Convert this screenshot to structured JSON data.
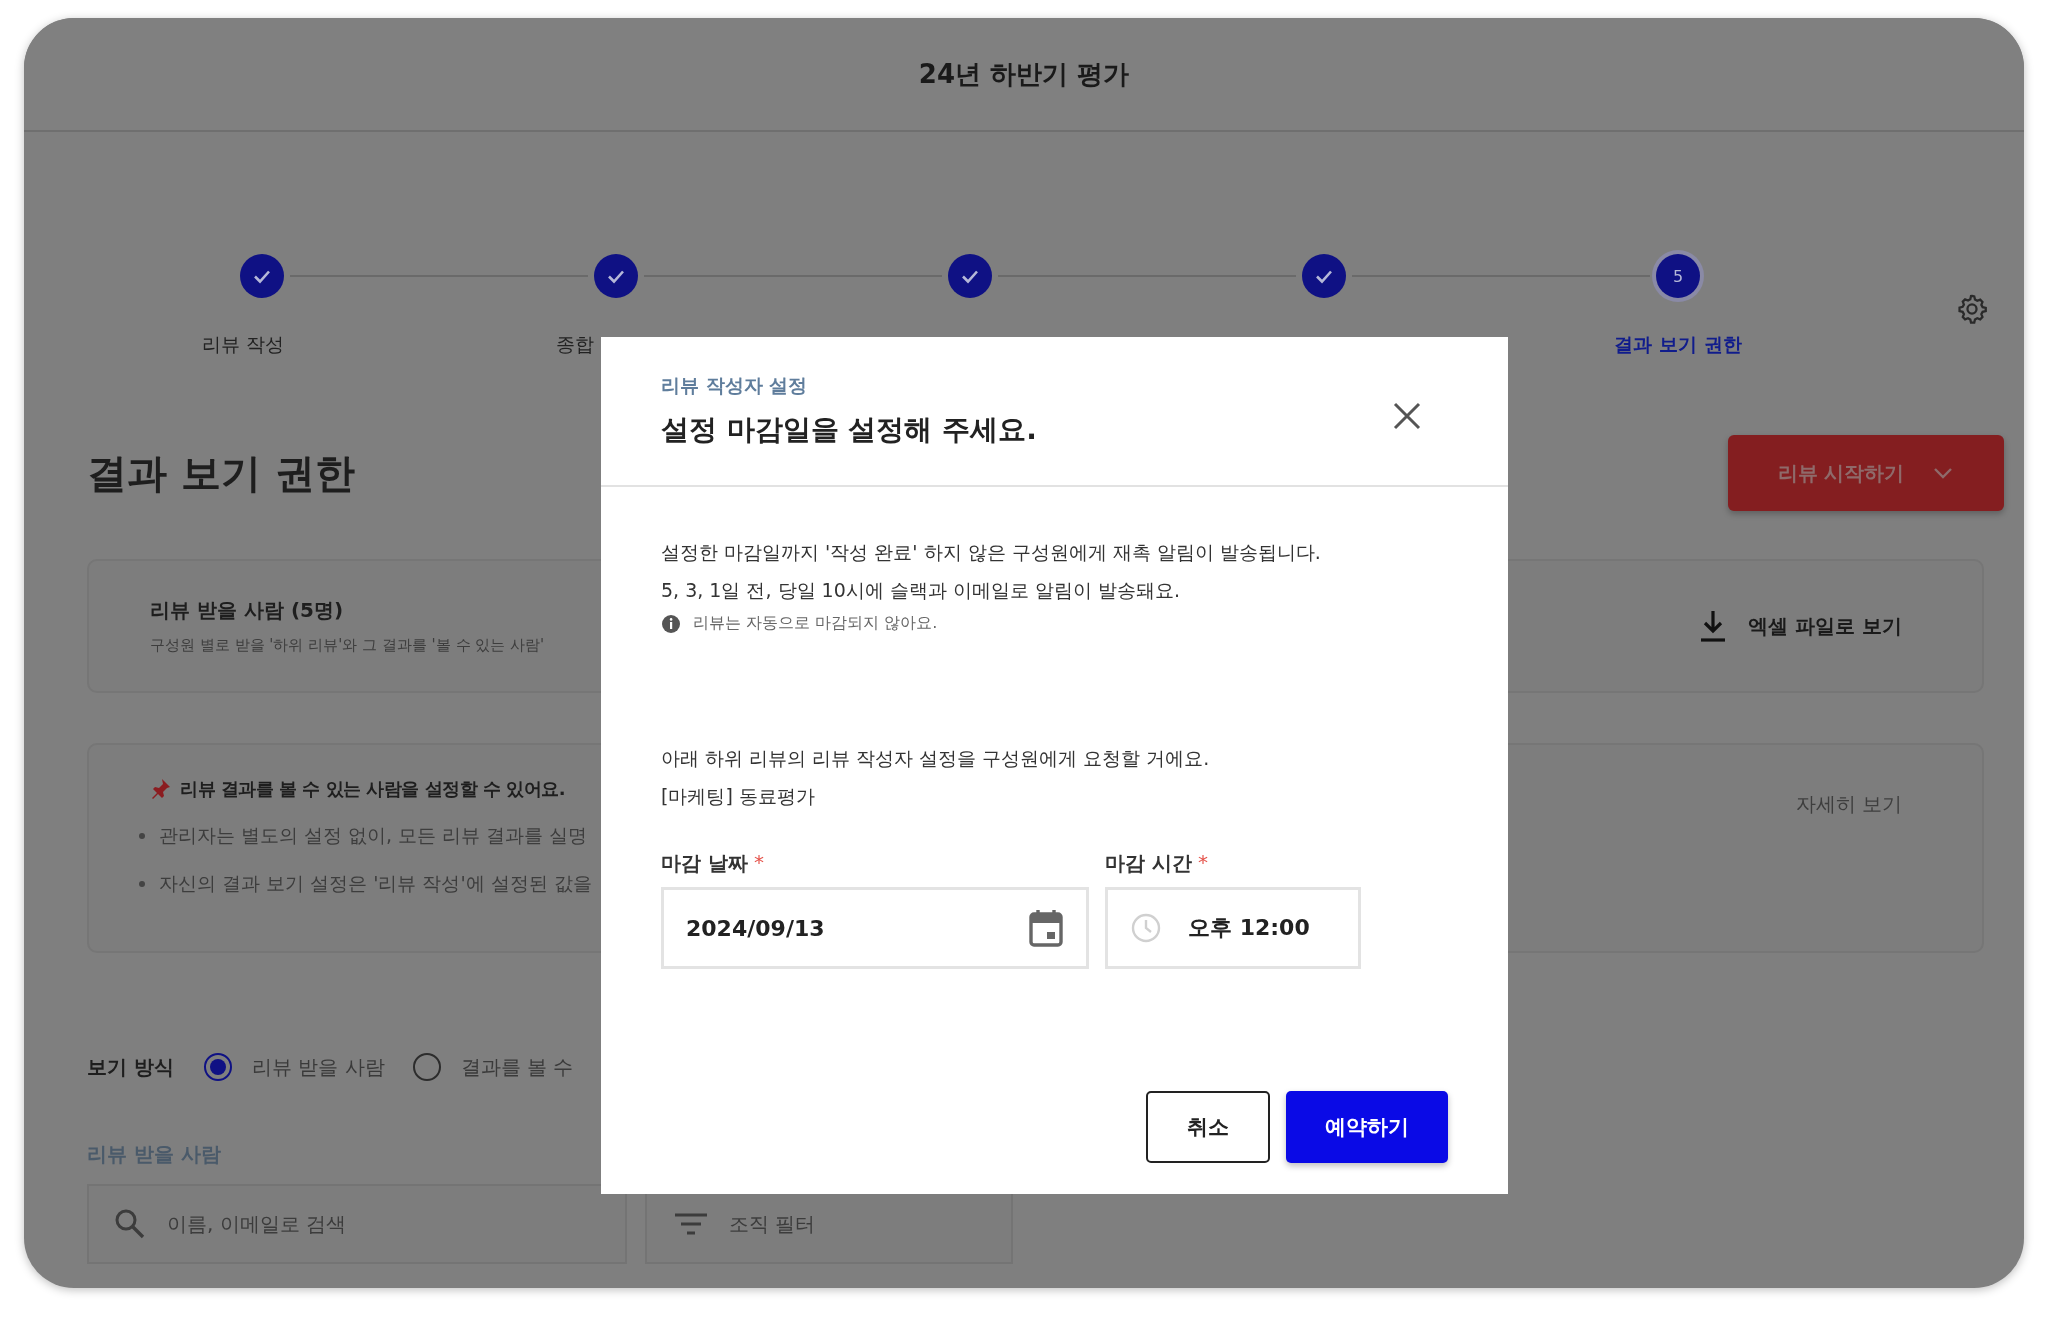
{
  "window": {
    "title": "24년 하반기 평가"
  },
  "steps": [
    {
      "label": "리뷰 작성",
      "done": true,
      "selected": false
    },
    {
      "label": "종합",
      "done": true,
      "selected": false
    },
    {
      "done": true,
      "selected": false
    },
    {
      "done": true,
      "selected": false
    },
    {
      "number": "5",
      "label": "결과 보기 권한",
      "done": false,
      "selected": true
    }
  ],
  "page_heading": "결과 보기 권한",
  "start_button": {
    "label": "리뷰 시작하기"
  },
  "reviewees_card": {
    "title": "리뷰 받을 사람 (5명)",
    "description": "구성원 별로 받을 '하위 리뷰'와 그 결과를 '볼 수 있는 사람'",
    "excel_link": "엑셀 파일로 보기"
  },
  "notice": {
    "title": "리뷰 결과를 볼 수 있는 사람을 설정할 수 있어요.",
    "bullets": [
      "관리자는 별도의 설정 없이, 모든 리뷰 결과를 실명",
      "자신의 결과 보기 설정은 '리뷰 작성'에 설정된 값을"
    ],
    "details_link": "자세히 보기"
  },
  "view_mode": {
    "label": "보기 방식",
    "options": [
      {
        "label": "리뷰 받을 사람",
        "selected": true
      },
      {
        "label": "결과를 볼 수",
        "selected": false
      }
    ]
  },
  "reviewee_section": {
    "label": "리뷰 받을 사람",
    "search": {
      "placeholder": "이름, 이메일로 검색"
    },
    "filter": {
      "label": "조직 필터"
    }
  },
  "modal": {
    "eyebrow": "리뷰 작성자 설정",
    "title": "설정 마감일을 설정해 주세요.",
    "description": [
      "설정한 마감일까지 '작성 완료' 하지 않은 구성원에게 재촉 알림이 발송됩니다.",
      "5, 3, 1일 전, 당일 10시에 슬랙과 이메일로 알림이 발송돼요."
    ],
    "note": "리뷰는 자동으로 마감되지 않아요.",
    "request_text": "아래 하위 리뷰의 리뷰 작성자 설정을 구성원에게 요청할 거에요.",
    "review_name": "[마케팅] 동료평가",
    "fields": [
      {
        "kind": "date",
        "label": "마감 날짜",
        "required_mark": "*",
        "value": "2024/09/13"
      },
      {
        "kind": "time",
        "label": "마감 시간",
        "required_mark": "*",
        "value": "오후 12:00"
      }
    ],
    "buttons": [
      {
        "kind": "secondary",
        "label": "취소"
      },
      {
        "kind": "primary",
        "label": "예약하기"
      }
    ]
  }
}
